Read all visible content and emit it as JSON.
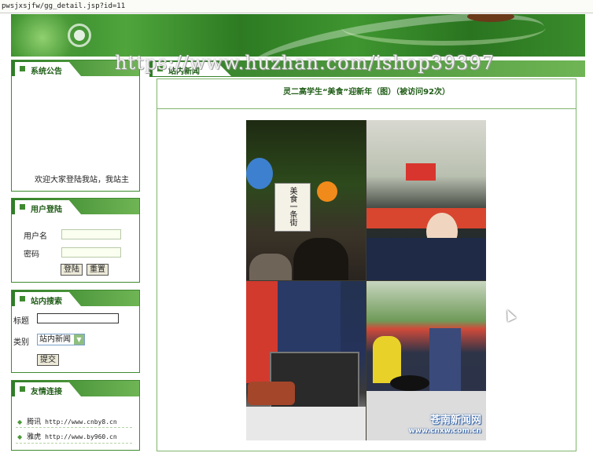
{
  "address_bar": {
    "url": "pwsjxsjfw/gg_detail.jsp?id=11"
  },
  "watermark": "https://www.huzhan.com/ishop39397",
  "sidebar": {
    "announcement": {
      "title": "系统公告",
      "text": "欢迎大家登陆我站，我站主"
    },
    "login": {
      "title": "用户登陆",
      "username_label": "用户名",
      "password_label": "密码",
      "login_button": "登陆",
      "reset_button": "重置"
    },
    "search": {
      "title": "站内搜索",
      "title_label": "标题",
      "category_label": "类别",
      "category_value": "站内新闻",
      "submit_button": "提交"
    },
    "friend_links": {
      "title": "友情连接",
      "items": [
        {
          "name": "腾讯",
          "url": "http://www.cnby8.cn"
        },
        {
          "name": "雅虎",
          "url": "http://www.by960.cn"
        }
      ]
    }
  },
  "main": {
    "section_title": "站内新闻",
    "article_title": "灵二高学生“美食”迎新年（图）（被访问92次）",
    "photo_watermark": {
      "line1": "苍南新闻网",
      "line2": "www.cnxw.com.cn"
    },
    "photo_sign": "美食一条街"
  }
}
